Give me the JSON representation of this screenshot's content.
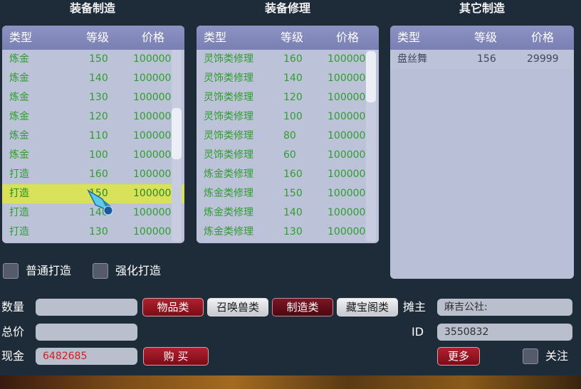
{
  "sections": {
    "make_title": "装备制造",
    "repair_title": "装备修理",
    "other_title": "其它制造"
  },
  "headers": {
    "type": "类型",
    "level": "等级",
    "price": "价格"
  },
  "make_rows": [
    {
      "type": "炼金",
      "level": "150",
      "price": "100000"
    },
    {
      "type": "炼金",
      "level": "140",
      "price": "100000"
    },
    {
      "type": "炼金",
      "level": "130",
      "price": "100000"
    },
    {
      "type": "炼金",
      "level": "120",
      "price": "100000"
    },
    {
      "type": "炼金",
      "level": "110",
      "price": "100000"
    },
    {
      "type": "炼金",
      "level": "100",
      "price": "100000"
    },
    {
      "type": "打造",
      "level": "160",
      "price": "100000"
    },
    {
      "type": "打造",
      "level": "150",
      "price": "100000"
    },
    {
      "type": "打造",
      "level": "140",
      "price": "100000"
    },
    {
      "type": "打造",
      "level": "130",
      "price": "100000"
    }
  ],
  "repair_rows": [
    {
      "type": "灵饰类修理",
      "level": "160",
      "price": "100000"
    },
    {
      "type": "灵饰类修理",
      "level": "140",
      "price": "100000"
    },
    {
      "type": "灵饰类修理",
      "level": "120",
      "price": "100000"
    },
    {
      "type": "灵饰类修理",
      "level": "100",
      "price": "100000"
    },
    {
      "type": "灵饰类修理",
      "level": "80",
      "price": "100000"
    },
    {
      "type": "灵饰类修理",
      "level": "60",
      "price": "100000"
    },
    {
      "type": "炼金类修理",
      "level": "160",
      "price": "100000"
    },
    {
      "type": "炼金类修理",
      "level": "150",
      "price": "100000"
    },
    {
      "type": "炼金类修理",
      "level": "140",
      "price": "100000"
    },
    {
      "type": "炼金类修理",
      "level": "130",
      "price": "100000"
    }
  ],
  "other_rows": [
    {
      "type": "盘丝舞",
      "level": "156",
      "price": "29999"
    }
  ],
  "options": {
    "normal": "普通打造",
    "enhanced": "强化打造"
  },
  "form": {
    "quantity_label": "数量",
    "total_label": "总价",
    "cash_label": "现金",
    "cash_value": "6482685",
    "buy_label": "购 买"
  },
  "categories": {
    "items": "物品类",
    "summon": "召唤兽类",
    "crafting": "制造类",
    "treasure": "藏宝阁类"
  },
  "stall": {
    "owner_label": "摊主",
    "owner_value": "麻吉公社:",
    "id_label": "ID",
    "id_value": "3550832",
    "more_label": "更多",
    "follow_label": "关注"
  },
  "colors": {
    "row_text": "#2e9e2e",
    "selected_row": "#d9e15a",
    "header": "#7a80b3",
    "cash_text": "#d02020"
  }
}
